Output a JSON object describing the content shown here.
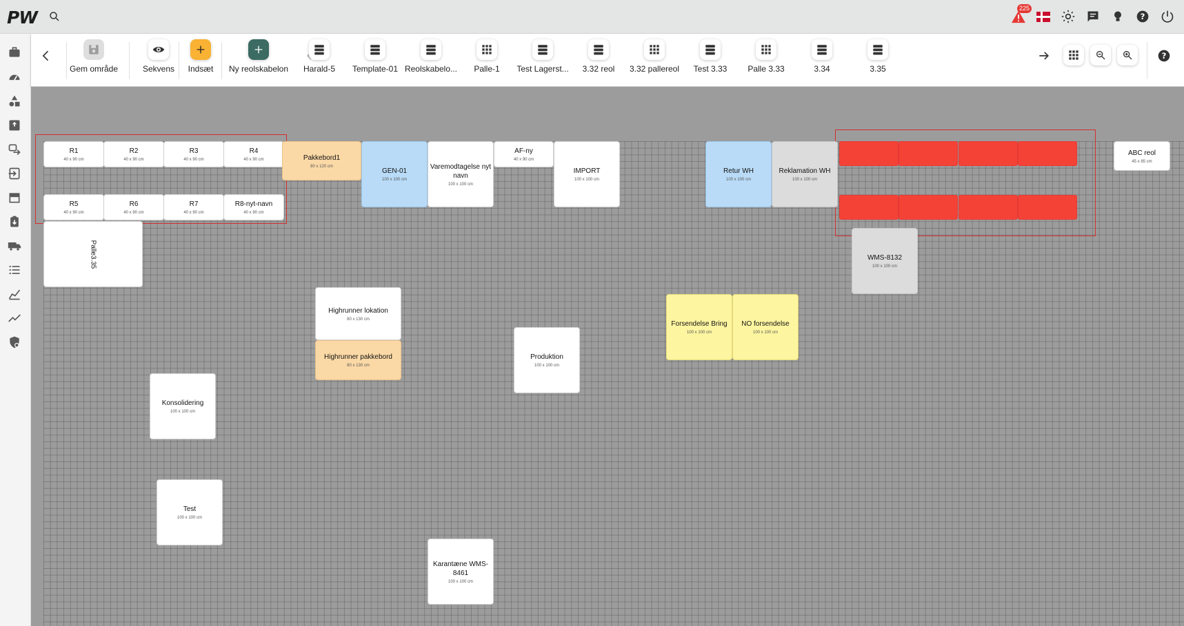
{
  "app": {
    "logo": "PW",
    "notifications": "225"
  },
  "toolbar": {
    "save": "Gem område",
    "sequence": "Sekvens",
    "insert": "Indsæt",
    "new_template": "Ny reolskabelon",
    "templates": [
      {
        "label": "Harald-5",
        "icon": "shelf"
      },
      {
        "label": "Template-01",
        "icon": "shelf"
      },
      {
        "label": "Reolskabelo...",
        "icon": "shelf"
      },
      {
        "label": "Palle-1",
        "icon": "grid"
      },
      {
        "label": "Test Lagerst...",
        "icon": "shelf"
      },
      {
        "label": "3.32 reol",
        "icon": "shelf"
      },
      {
        "label": "3.32 pallereol",
        "icon": "grid"
      },
      {
        "label": "Test 3.33",
        "icon": "shelf"
      },
      {
        "label": "Palle 3.33",
        "icon": "grid"
      },
      {
        "label": "3.34",
        "icon": "shelf"
      },
      {
        "label": "3.35",
        "icon": "shelf"
      }
    ]
  },
  "colors": {
    "accent_orange": "#f9b233",
    "accent_teal": "#3b6b62",
    "selected_red": "#f44336",
    "peach": "#fbd9a6",
    "blue": "#b9dbf7",
    "yellow": "#fdf5a0",
    "grey": "#dcdcdc"
  },
  "locations": {
    "r1": {
      "name": "R1",
      "dim": "40 x 90 cm"
    },
    "r2": {
      "name": "R2",
      "dim": "40 x 90 cm"
    },
    "r3": {
      "name": "R3",
      "dim": "40 x 90 cm"
    },
    "r4": {
      "name": "R4",
      "dim": "40 x 90 cm"
    },
    "r5": {
      "name": "R5",
      "dim": "40 x 90 cm"
    },
    "r6": {
      "name": "R6",
      "dim": "40 x 90 cm"
    },
    "r7": {
      "name": "R7",
      "dim": "40 x 90 cm"
    },
    "r8": {
      "name": "R8-nyt-navn",
      "dim": "40 x 90 cm"
    },
    "palle335": {
      "name": "Palle3.35"
    },
    "pakkebord1": {
      "name": "Pakkebord1",
      "dim": "80 x 120 cm"
    },
    "gen01": {
      "name": "GEN-01",
      "dim": "100 x 100 cm"
    },
    "varemodtagelse": {
      "name": "Varemodtagelse nyt navn",
      "dim": "100 x 100 cm"
    },
    "afny": {
      "name": "AF-ny",
      "dim": "40 x 90 cm"
    },
    "import": {
      "name": "IMPORT",
      "dim": "100 x 100 cm"
    },
    "returwh": {
      "name": "Retur WH",
      "dim": "100 x 100 cm"
    },
    "reklamation": {
      "name": "Reklamation WH",
      "dim": "100 x 100 cm"
    },
    "abcreol": {
      "name": "ABC reol",
      "dim": "45 x 85 cm"
    },
    "wms8132": {
      "name": "WMS-8132",
      "dim": "100 x 100 cm"
    },
    "highrunner_lok": {
      "name": "Highrunner lokation",
      "dim": "80 x 130 cm"
    },
    "highrunner_pak": {
      "name": "Highrunner pakkebord",
      "dim": "80 x 130 cm"
    },
    "produktion": {
      "name": "Produktion",
      "dim": "100 x 100 cm"
    },
    "forsendelse": {
      "name": "Forsendelse Bring",
      "dim": "100 x 100 cm"
    },
    "noforsendelse": {
      "name": "NO forsendelse",
      "dim": "100 x 100 cm"
    },
    "konsolidering": {
      "name": "Konsolidering",
      "dim": "100 x 100 cm"
    },
    "test": {
      "name": "Test",
      "dim": "100 x 100 cm"
    },
    "karantaene": {
      "name": "Karantæne WMS-8461",
      "dim": "100 x 100 cm"
    }
  }
}
